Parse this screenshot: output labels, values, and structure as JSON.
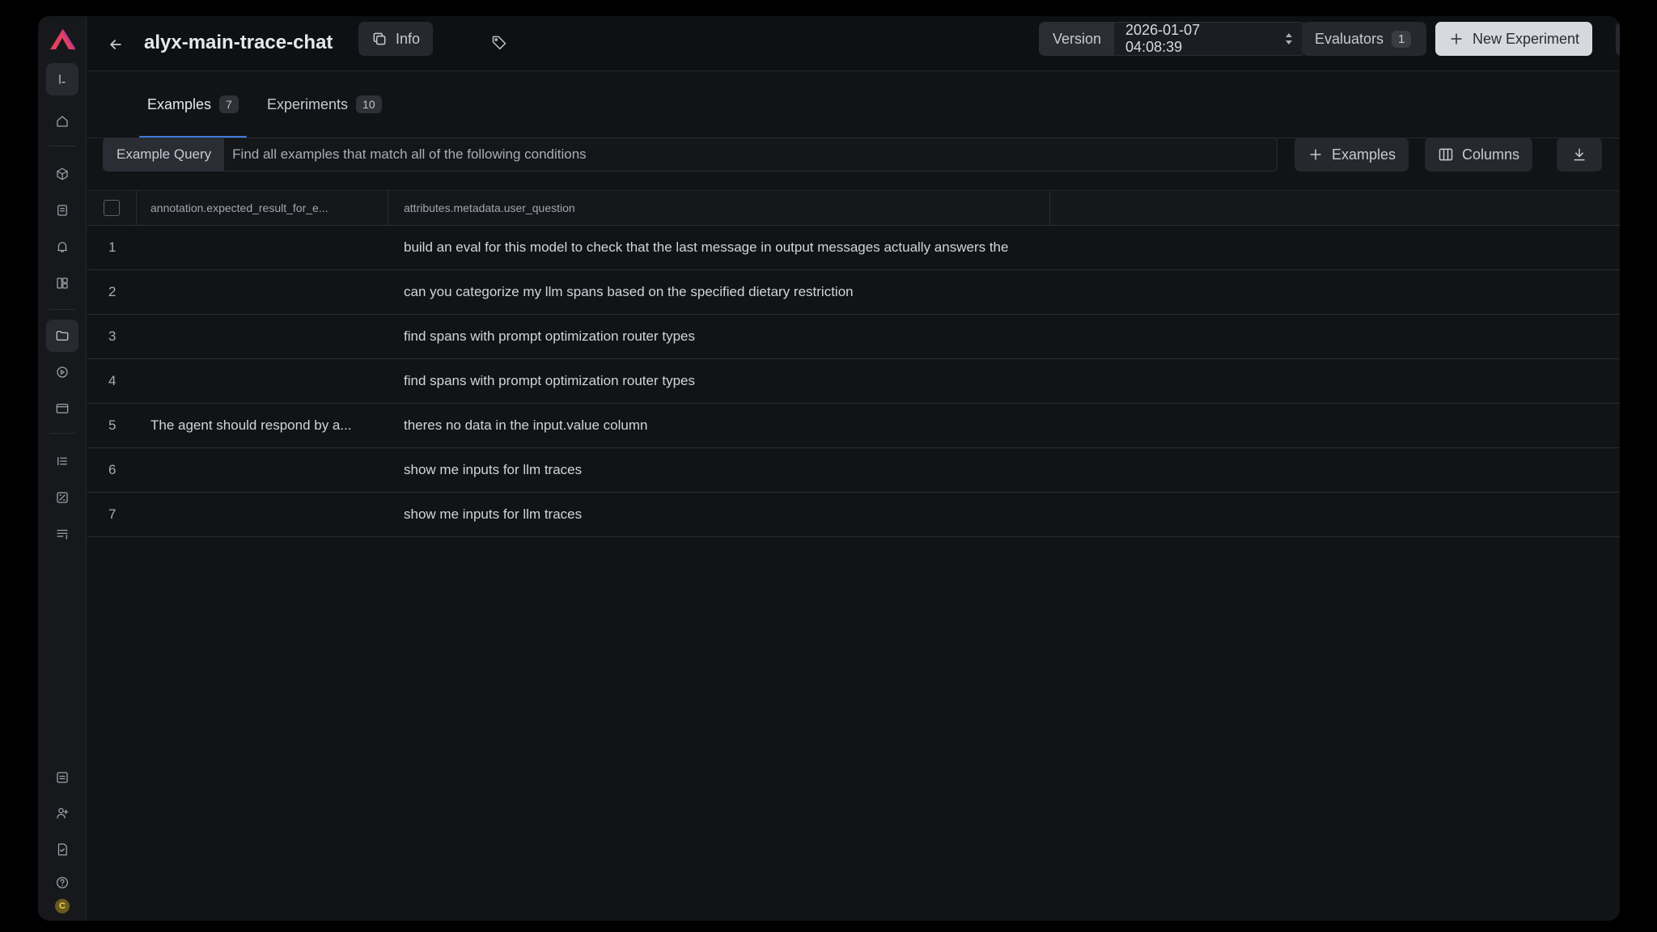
{
  "header": {
    "title": "alyx-main-trace-chat",
    "info_label": "Info",
    "version_label": "Version",
    "version_value": "2026-01-07 04:08:39",
    "evaluators_label": "Evaluators",
    "evaluators_count": "1",
    "new_experiment_label": "New Experiment",
    "more_label": "···"
  },
  "tabs": [
    {
      "label": "Examples",
      "count": "7",
      "active": true
    },
    {
      "label": "Experiments",
      "count": "10",
      "active": false
    }
  ],
  "query": {
    "label": "Example Query",
    "placeholder": "Find all examples that match all of the following conditions"
  },
  "toolbar": {
    "add_examples_label": "Examples",
    "columns_label": "Columns"
  },
  "table": {
    "columns": [
      "annotation.expected_result_for_e...",
      "attributes.metadata.user_question"
    ],
    "rows": [
      {
        "num": "1",
        "c1": "",
        "c2": "build an eval for this model to check that the last message in output messages actually answers the"
      },
      {
        "num": "2",
        "c1": "",
        "c2": "can you categorize my llm spans based on the specified dietary restriction"
      },
      {
        "num": "3",
        "c1": "",
        "c2": "find spans with prompt optimization router types"
      },
      {
        "num": "4",
        "c1": "",
        "c2": "find spans with prompt optimization router types"
      },
      {
        "num": "5",
        "c1": "The agent should respond by a...",
        "c2": "theres no data in the input.value column"
      },
      {
        "num": "6",
        "c1": "",
        "c2": "show me inputs for llm traces"
      },
      {
        "num": "7",
        "c1": "",
        "c2": "show me inputs for llm traces"
      }
    ]
  },
  "sidebar": {
    "avatar_initial": "C",
    "icons": [
      "terminal-icon",
      "home-icon",
      "cube-icon",
      "database-icon",
      "bell-icon",
      "dashboard-icon",
      "folder-icon",
      "play-icon",
      "window-icon",
      "list-icon",
      "chart-icon",
      "menu-icon",
      "monitor-icon",
      "add-user-icon",
      "document-icon",
      "help-icon"
    ]
  },
  "colors": {
    "brand": "#e4405f",
    "accent": "#3f7be0",
    "background": "#121316"
  }
}
